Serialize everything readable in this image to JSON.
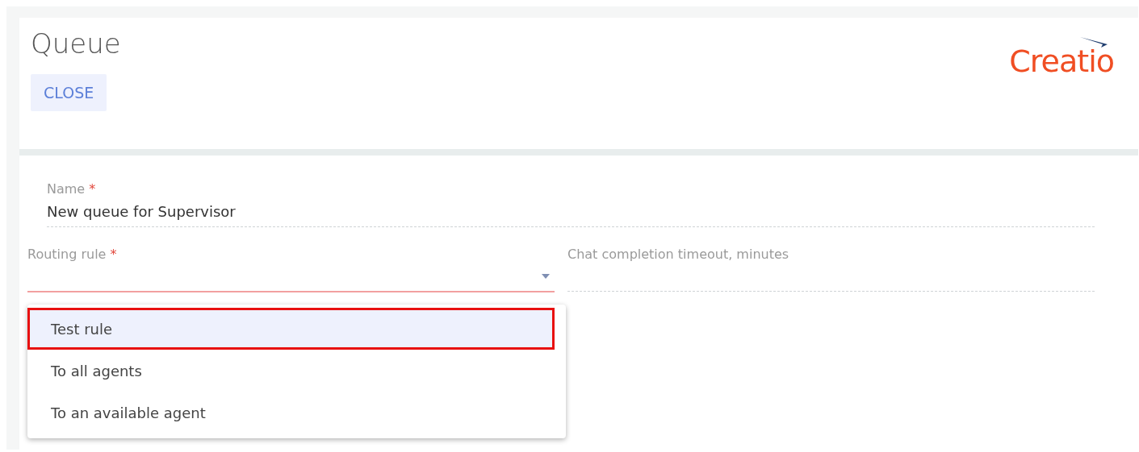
{
  "header": {
    "title": "Queue",
    "close_button": "CLOSE",
    "logo": "Creatio"
  },
  "fields": {
    "name": {
      "label": "Name",
      "required_mark": "*",
      "value": "New queue for Supervisor"
    },
    "routing_rule": {
      "label": "Routing rule",
      "required_mark": "*",
      "expanded": true,
      "options": [
        {
          "label": "Test rule",
          "selected": true
        },
        {
          "label": "To all agents",
          "selected": false
        },
        {
          "label": "To an available agent",
          "selected": false
        }
      ]
    },
    "chat_timeout": {
      "label": "Chat completion timeout, minutes"
    }
  }
}
